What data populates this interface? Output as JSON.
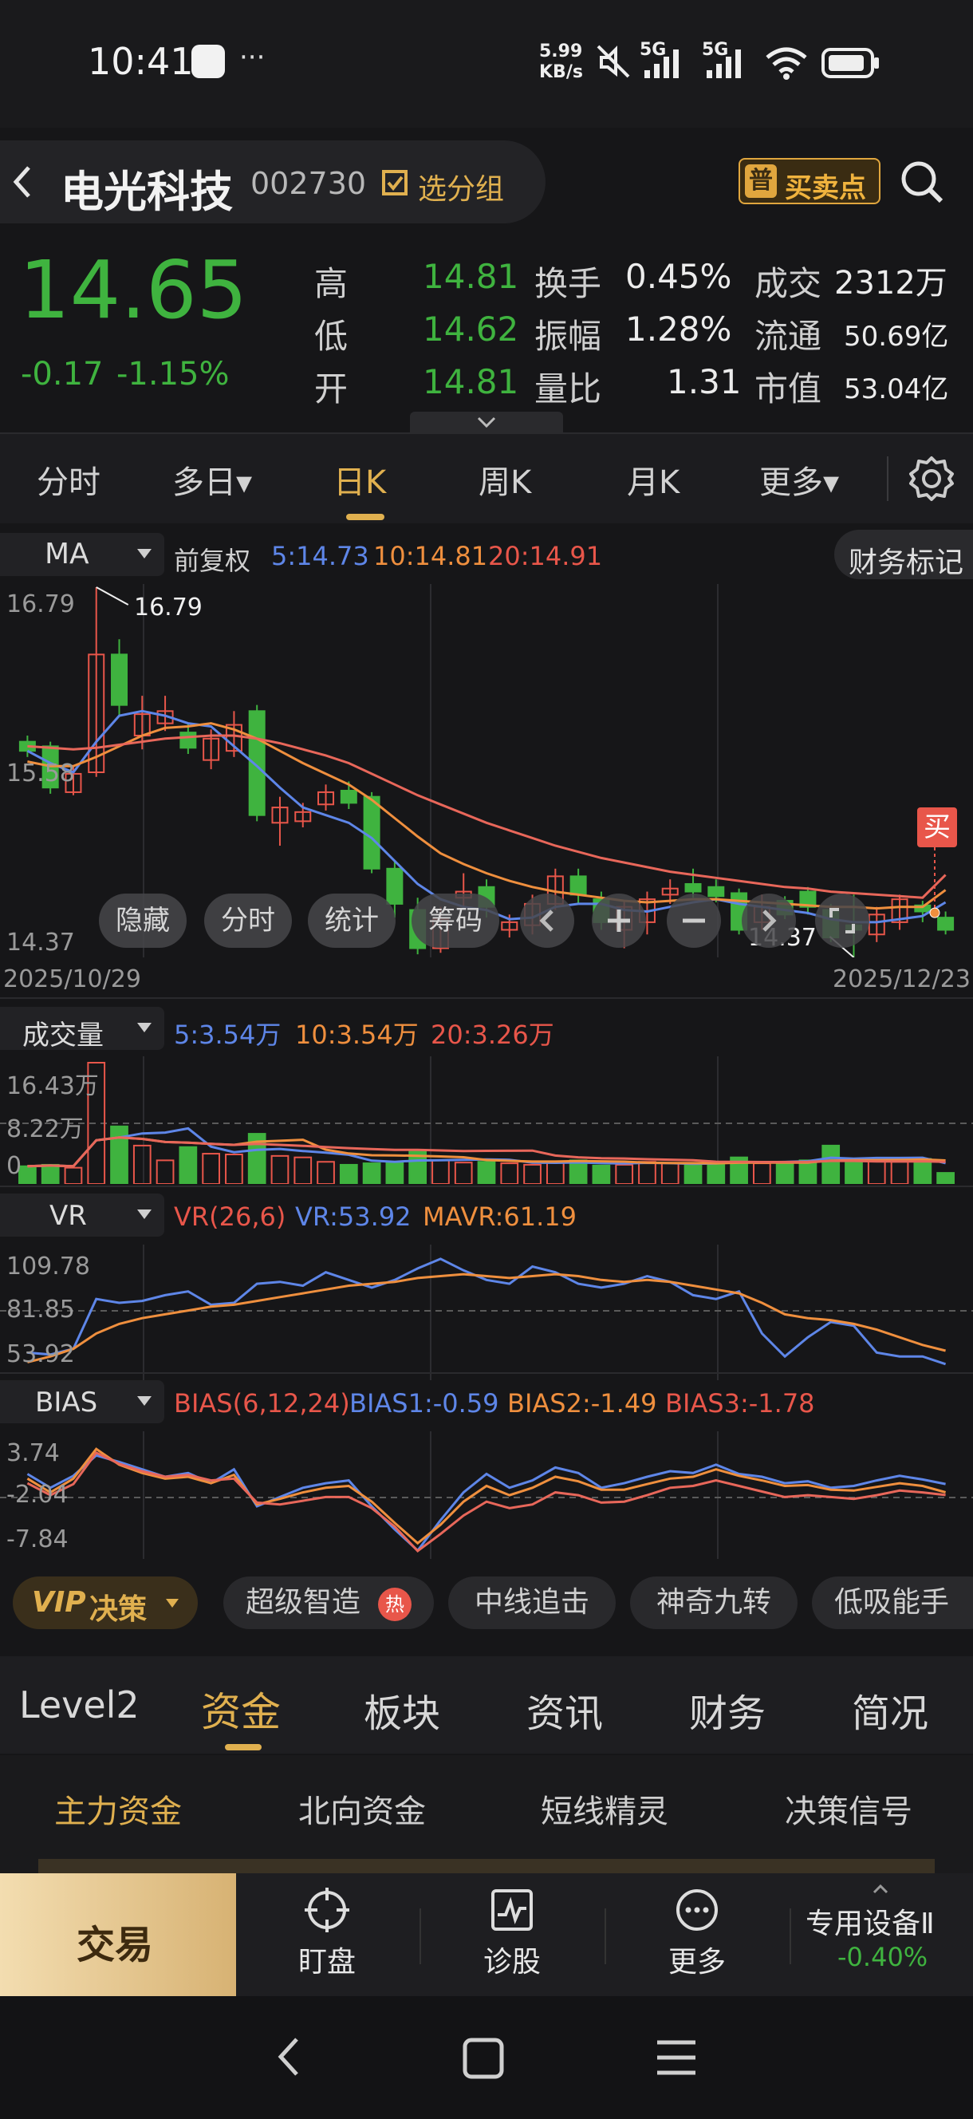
{
  "status_bar": {
    "time": "10:41",
    "net_speed_value": "5.99",
    "net_speed_unit": "KB/s",
    "net1": "5G",
    "net2": "5G",
    "more": "···"
  },
  "header": {
    "name": "电光科技",
    "code": "002730",
    "watch_label": "选分组",
    "buy_sell_badge": "普",
    "buy_sell_label": "买卖点"
  },
  "quote": {
    "price": "14.65",
    "change": "-0.17",
    "change_pct": "-1.15%",
    "high_label": "高",
    "high": "14.81",
    "low_label": "低",
    "low": "14.62",
    "open_label": "开",
    "open": "14.81",
    "turnover_label": "换手",
    "turnover": "0.45%",
    "amplitude_label": "振幅",
    "amplitude": "1.28%",
    "vol_ratio_label": "量比",
    "vol_ratio": "1.31",
    "volume_label": "成交",
    "volume": "2312万",
    "float_label": "流通",
    "float_cap": "50.69亿",
    "mcap_label": "市值",
    "mcap": "53.04亿"
  },
  "period_tabs": [
    "分时",
    "多日▾",
    "日K",
    "周K",
    "月K",
    "更多▾"
  ],
  "active_period": "日K",
  "ma_bar": {
    "indicator": "MA",
    "adjust": "前复权",
    "ma5": "5:14.73",
    "ma10": "10:14.81",
    "ma20": "20:14.91",
    "finance_mark": "财务标记"
  },
  "kline": {
    "y_top": "16.79",
    "y_mid": "15.58",
    "y_bottom": "14.37",
    "max_label": "16.79",
    "min_label": "14.37",
    "date_start": "2025/10/29",
    "date_end": "2025/12/23",
    "buy_marker": "买",
    "controls": [
      "隐藏",
      "分时",
      "统计",
      "筹码"
    ]
  },
  "volume_panel": {
    "label": "成交量",
    "ma5": "5:3.54万",
    "ma10": "10:3.54万",
    "ma20": "20:3.26万",
    "y_top": "16.43万",
    "y_mid": "8.22万",
    "y_bottom": "0"
  },
  "vr_panel": {
    "label": "VR",
    "params": "VR(26,6)",
    "vr": "VR:53.92",
    "mavr": "MAVR:61.19",
    "y_top": "109.78",
    "y_mid": "81.85",
    "y_bottom": "53.92"
  },
  "bias_panel": {
    "label": "BIAS",
    "params": "BIAS(6,12,24)",
    "b1": "BIAS1:-0.59",
    "b2": "BIAS2:-1.49",
    "b3": "BIAS3:-1.78",
    "y_top": "3.74",
    "y_mid": "-2.04",
    "y_bottom": "-7.84"
  },
  "strategy_bar": {
    "vip": "VIP",
    "vip_label": "决策",
    "chips": [
      "超级智造",
      "中线追击",
      "神奇九转",
      "低吸能手"
    ],
    "hot": "热"
  },
  "info_tabs": [
    "Level2",
    "资金",
    "板块",
    "资讯",
    "财务",
    "简况"
  ],
  "active_info_tab": "资金",
  "sub_tabs": [
    "主力资金",
    "北向资金",
    "短线精灵",
    "决策信号"
  ],
  "bottom_nav": {
    "trade": "交易",
    "watch": "盯盘",
    "diagnose": "诊股",
    "more": "更多",
    "sector": "专用设备Ⅱ",
    "sector_change": "-0.40%"
  },
  "colors": {
    "up": "#e8564a",
    "down": "#3fb33f",
    "ma5": "#5e86e8",
    "ma10": "#ef8f3e",
    "ma20": "#e8675a",
    "accent": "#e0b04f",
    "bg": "#161618"
  },
  "icons": {
    "back": "chevron-left-icon",
    "search": "search-icon",
    "settings": "gear-icon"
  },
  "chart_data": {
    "type": "candlestick",
    "x_range": [
      "2025/10/29",
      "2025/12/23"
    ],
    "ylim": [
      14.37,
      16.79
    ],
    "candles": [
      {
        "o": 15.78,
        "c": 15.72,
        "h": 15.82,
        "l": 15.68
      },
      {
        "o": 15.75,
        "c": 15.48,
        "h": 15.78,
        "l": 15.44
      },
      {
        "o": 15.45,
        "c": 15.57,
        "h": 15.62,
        "l": 15.43
      },
      {
        "o": 15.58,
        "c": 16.35,
        "h": 16.79,
        "l": 15.55
      },
      {
        "o": 16.35,
        "c": 16.02,
        "h": 16.45,
        "l": 15.95
      },
      {
        "o": 15.82,
        "c": 15.96,
        "h": 16.08,
        "l": 15.73
      },
      {
        "o": 15.9,
        "c": 15.98,
        "h": 16.08,
        "l": 15.85
      },
      {
        "o": 15.84,
        "c": 15.74,
        "h": 15.9,
        "l": 15.7
      },
      {
        "o": 15.66,
        "c": 15.8,
        "h": 15.86,
        "l": 15.6
      },
      {
        "o": 15.72,
        "c": 15.89,
        "h": 15.98,
        "l": 15.68
      },
      {
        "o": 15.98,
        "c": 15.3,
        "h": 16.02,
        "l": 15.26
      },
      {
        "o": 15.25,
        "c": 15.35,
        "h": 15.42,
        "l": 15.1
      },
      {
        "o": 15.26,
        "c": 15.32,
        "h": 15.38,
        "l": 15.22
      },
      {
        "o": 15.37,
        "c": 15.45,
        "h": 15.5,
        "l": 15.33
      },
      {
        "o": 15.46,
        "c": 15.38,
        "h": 15.52,
        "l": 15.34
      },
      {
        "o": 15.42,
        "c": 14.95,
        "h": 15.45,
        "l": 14.92
      },
      {
        "o": 14.95,
        "c": 14.72,
        "h": 15.0,
        "l": 14.63
      },
      {
        "o": 14.68,
        "c": 14.43,
        "h": 14.76,
        "l": 14.39
      },
      {
        "o": 14.43,
        "c": 14.62,
        "h": 14.7,
        "l": 14.4
      },
      {
        "o": 14.76,
        "c": 14.8,
        "h": 14.92,
        "l": 14.7
      },
      {
        "o": 14.83,
        "c": 14.7,
        "h": 14.88,
        "l": 14.63
      },
      {
        "o": 14.55,
        "c": 14.6,
        "h": 14.65,
        "l": 14.5
      },
      {
        "o": 14.58,
        "c": 14.72,
        "h": 14.78,
        "l": 14.52
      },
      {
        "o": 14.72,
        "c": 14.9,
        "h": 14.95,
        "l": 14.68
      },
      {
        "o": 14.9,
        "c": 14.78,
        "h": 14.95,
        "l": 14.72
      },
      {
        "o": 14.75,
        "c": 14.6,
        "h": 14.8,
        "l": 14.55
      },
      {
        "o": 14.55,
        "c": 14.7,
        "h": 14.74,
        "l": 14.43
      },
      {
        "o": 14.6,
        "c": 14.75,
        "h": 14.8,
        "l": 14.52
      },
      {
        "o": 14.78,
        "c": 14.82,
        "h": 14.88,
        "l": 14.72
      },
      {
        "o": 14.85,
        "c": 14.8,
        "h": 14.95,
        "l": 14.76
      },
      {
        "o": 14.83,
        "c": 14.77,
        "h": 14.88,
        "l": 14.73
      },
      {
        "o": 14.79,
        "c": 14.55,
        "h": 14.82,
        "l": 14.52
      },
      {
        "o": 14.6,
        "c": 14.7,
        "h": 14.78,
        "l": 14.55
      },
      {
        "o": 14.74,
        "c": 14.65,
        "h": 14.77,
        "l": 14.62
      },
      {
        "o": 14.8,
        "c": 14.7,
        "h": 14.83,
        "l": 14.65
      },
      {
        "o": 14.68,
        "c": 14.5,
        "h": 14.72,
        "l": 14.47
      },
      {
        "o": 14.58,
        "c": 14.55,
        "h": 14.78,
        "l": 14.37
      },
      {
        "o": 14.52,
        "c": 14.65,
        "h": 14.7,
        "l": 14.47
      },
      {
        "o": 14.6,
        "c": 14.75,
        "h": 14.78,
        "l": 14.55
      },
      {
        "o": 14.71,
        "c": 14.67,
        "h": 14.74,
        "l": 14.6
      },
      {
        "o": 14.63,
        "c": 14.55,
        "h": 14.67,
        "l": 14.52
      }
    ],
    "ma5": [
      15.72,
      15.64,
      15.58,
      15.78,
      15.95,
      15.98,
      15.95,
      15.9,
      15.88,
      15.75,
      15.62,
      15.48,
      15.35,
      15.3,
      15.25,
      15.15,
      15.0,
      14.85,
      14.75,
      14.7,
      14.68,
      14.62,
      14.63,
      14.7,
      14.72,
      14.72,
      14.68,
      14.67,
      14.7,
      14.73,
      14.75,
      14.72,
      14.7,
      14.68,
      14.66,
      14.62,
      14.6,
      14.6,
      14.62,
      14.64,
      14.73
    ],
    "ma10": [
      15.65,
      15.62,
      15.62,
      15.68,
      15.75,
      15.82,
      15.87,
      15.88,
      15.9,
      15.86,
      15.8,
      15.72,
      15.64,
      15.57,
      15.5,
      15.4,
      15.28,
      15.16,
      15.05,
      14.98,
      14.92,
      14.87,
      14.83,
      14.8,
      14.78,
      14.76,
      14.74,
      14.73,
      14.74,
      14.75,
      14.75,
      14.74,
      14.73,
      14.72,
      14.71,
      14.7,
      14.7,
      14.69,
      14.7,
      14.7,
      14.81
    ],
    "ma20": [
      15.75,
      15.74,
      15.73,
      15.74,
      15.76,
      15.78,
      15.8,
      15.81,
      15.82,
      15.82,
      15.8,
      15.77,
      15.73,
      15.69,
      15.64,
      15.57,
      15.5,
      15.43,
      15.37,
      15.31,
      15.25,
      15.2,
      15.15,
      15.1,
      15.06,
      15.02,
      14.99,
      14.96,
      14.93,
      14.91,
      14.89,
      14.87,
      14.85,
      14.83,
      14.82,
      14.8,
      14.79,
      14.78,
      14.77,
      14.76,
      14.91
    ],
    "volume": [
      2.4,
      2.6,
      2.2,
      16.43,
      7.8,
      5.2,
      3.2,
      5.0,
      4.1,
      4.0,
      6.8,
      3.8,
      3.6,
      3.0,
      2.6,
      2.8,
      3.0,
      4.5,
      3.2,
      2.9,
      3.0,
      2.8,
      2.6,
      3.0,
      3.2,
      2.5,
      2.6,
      3.0,
      2.8,
      2.7,
      2.8,
      3.6,
      2.8,
      3.0,
      3.2,
      5.2,
      3.0,
      3.2,
      3.0,
      3.4,
      1.5
    ],
    "volume_ylim": [
      0,
      16.43
    ],
    "vr": [
      60,
      59,
      62,
      88,
      86,
      87,
      90,
      92,
      85,
      86,
      96,
      97,
      95,
      102,
      98,
      94,
      98,
      104,
      109,
      103,
      98,
      96,
      105,
      102,
      96,
      94,
      96,
      100,
      97,
      90,
      88,
      92,
      70,
      58,
      68,
      76,
      74,
      60,
      58,
      58,
      54
    ],
    "mavr": [
      55,
      58,
      62,
      70,
      75,
      78,
      80,
      82,
      84,
      85,
      87,
      89,
      91,
      93,
      95,
      96,
      97,
      99,
      100,
      101,
      100,
      99,
      100,
      101,
      100,
      98,
      97,
      98,
      97,
      95,
      93,
      91,
      86,
      80,
      78,
      77,
      75,
      72,
      68,
      64,
      61
    ],
    "vr_ylim": [
      53.92,
      109.78
    ],
    "bias1": [
      0.5,
      -1.0,
      0.3,
      2.5,
      1.8,
      1.0,
      0.2,
      0.6,
      -0.5,
      1.0,
      -3.0,
      -2.0,
      -1.0,
      -0.5,
      -0.2,
      -3.0,
      -5.5,
      -7.8,
      -4.5,
      -1.5,
      0.5,
      -1.0,
      -0.2,
      1.2,
      0.6,
      -1.0,
      -0.5,
      0.2,
      0.8,
      0.6,
      1.5,
      0.5,
      0.2,
      -0.5,
      -0.3,
      -1.0,
      -0.8,
      -0.2,
      0.3,
      -0.1,
      -0.59
    ],
    "bias2": [
      0.0,
      -1.5,
      0.0,
      3.2,
      1.5,
      0.6,
      0.0,
      0.2,
      -0.5,
      0.4,
      -2.8,
      -2.2,
      -1.5,
      -1.0,
      -0.8,
      -2.5,
      -4.8,
      -7.0,
      -5.0,
      -2.5,
      -0.8,
      -1.8,
      -1.0,
      0.2,
      -0.3,
      -1.2,
      -1.2,
      -0.6,
      0.0,
      0.2,
      1.0,
      0.3,
      -0.2,
      -0.8,
      -0.7,
      -1.2,
      -1.3,
      -0.9,
      -0.5,
      -0.8,
      -1.49
    ],
    "bias3": [
      -0.5,
      -1.8,
      -0.6,
      2.8,
      1.6,
      0.8,
      0.2,
      0.4,
      -0.2,
      0.0,
      -2.6,
      -2.8,
      -2.4,
      -2.0,
      -2.0,
      -3.2,
      -5.2,
      -7.84,
      -6.0,
      -4.0,
      -2.5,
      -3.2,
      -2.8,
      -1.5,
      -1.8,
      -2.6,
      -2.5,
      -1.8,
      -1.0,
      -0.8,
      -0.2,
      -0.8,
      -1.4,
      -2.0,
      -1.8,
      -2.0,
      -2.2,
      -1.8,
      -1.3,
      -1.5,
      -1.78
    ],
    "bias_ylim": [
      -7.84,
      3.74
    ]
  }
}
